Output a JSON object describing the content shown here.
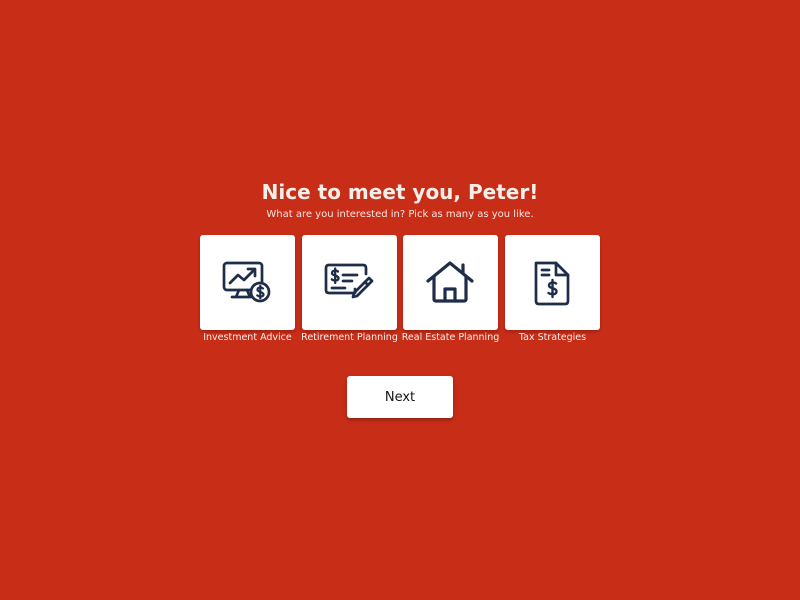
{
  "header": {
    "title": "Nice to meet you, Peter!",
    "subtitle": "What are you interested in? Pick as many as you like."
  },
  "options": [
    {
      "label": "Investment Advice",
      "icon": "investment-chart-icon"
    },
    {
      "label": "Retirement Planning",
      "icon": "check-pen-icon"
    },
    {
      "label": "Real Estate Planning",
      "icon": "house-icon"
    },
    {
      "label": "Tax Strategies",
      "icon": "tax-document-icon"
    }
  ],
  "actions": {
    "next_label": "Next"
  },
  "colors": {
    "background": "#c82d18",
    "card": "#ffffff",
    "icon": "#1e2d4a",
    "text_light": "#f3efe9"
  }
}
